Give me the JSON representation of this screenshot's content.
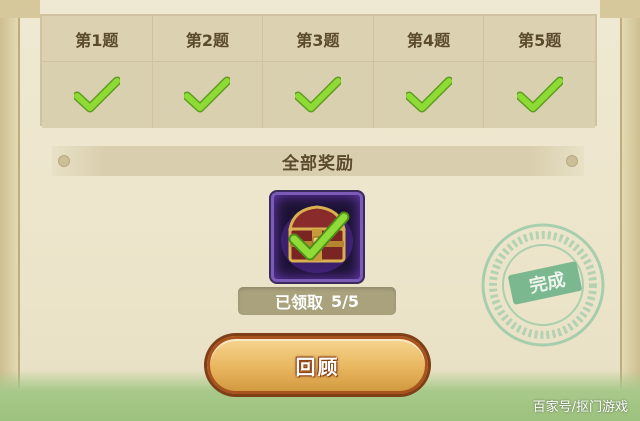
{
  "questions": {
    "headers": [
      "第1题",
      "第2题",
      "第3题",
      "第4题",
      "第5题"
    ],
    "results": [
      "correct-check-icon",
      "correct-check-icon",
      "correct-check-icon",
      "correct-check-icon",
      "correct-check-icon"
    ]
  },
  "reward": {
    "title": "全部奖励",
    "item_icon": "treasure-chest-icon",
    "status_label": "已领取",
    "progress_text": "5/5",
    "progress_value": 1.0
  },
  "stamp": {
    "label": "完成",
    "color": "#6fb38a"
  },
  "actions": {
    "review_label": "回顾"
  },
  "watermark": "百家号/抠门游戏",
  "colors": {
    "check": "#7fcf2e",
    "button": "#e8b65e",
    "chest_frame": "#7a5bb6"
  }
}
